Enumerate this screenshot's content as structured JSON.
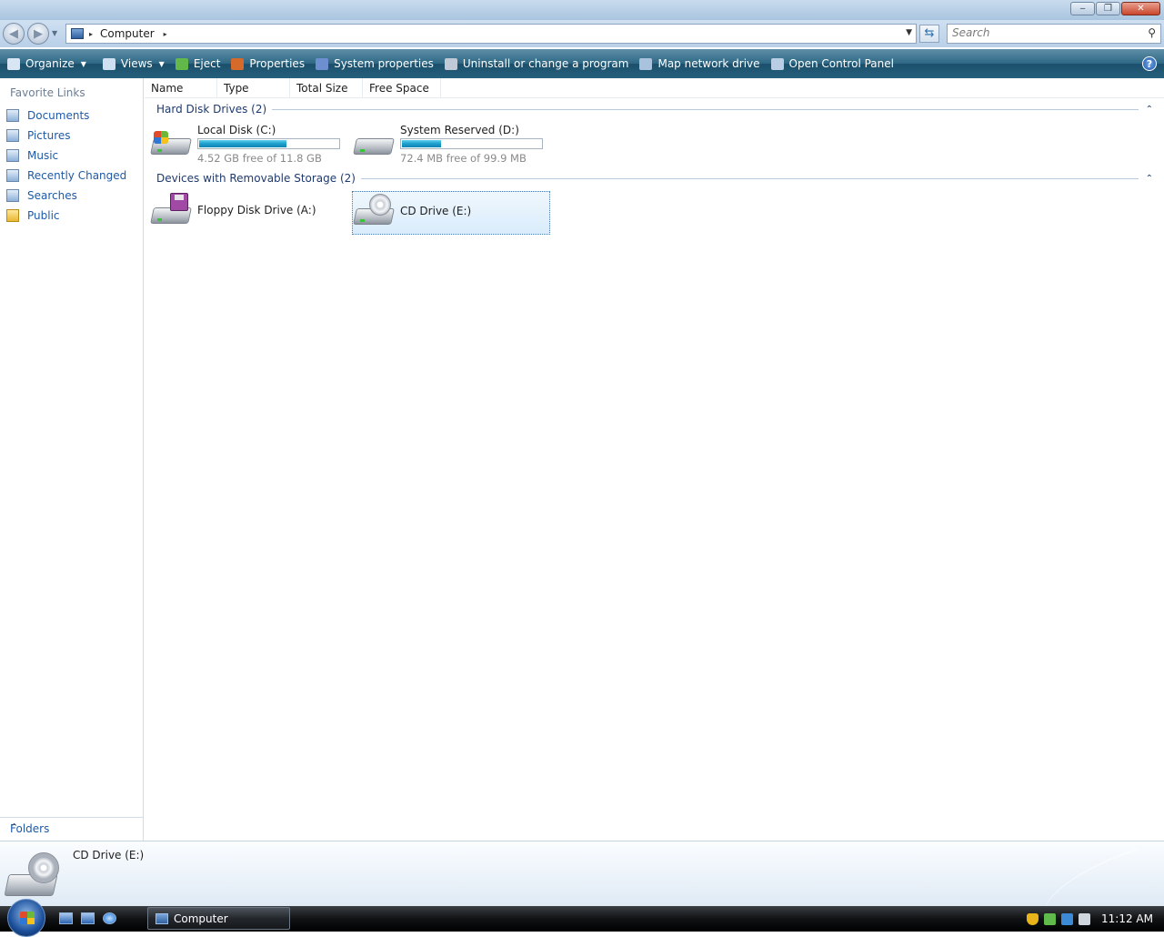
{
  "window": {
    "min_label": "‒",
    "max_label": "❐",
    "close_label": "✕"
  },
  "address": {
    "crumb": "Computer",
    "separator": "▸",
    "search_placeholder": "Search"
  },
  "toolbar": {
    "items": [
      {
        "label": "Organize",
        "icon": "organize-icon",
        "has_arrow": true
      },
      {
        "label": "Views",
        "icon": "views-icon",
        "has_arrow": true
      },
      {
        "label": "Eject",
        "icon": "eject-icon"
      },
      {
        "label": "Properties",
        "icon": "properties-icon"
      },
      {
        "label": "System properties",
        "icon": "system-properties-icon"
      },
      {
        "label": "Uninstall or change a program",
        "icon": "uninstall-icon"
      },
      {
        "label": "Map network drive",
        "icon": "network-drive-icon"
      },
      {
        "label": "Open Control Panel",
        "icon": "control-panel-icon"
      }
    ],
    "help_label": "?"
  },
  "sidebar": {
    "header": "Favorite Links",
    "items": [
      {
        "label": "Documents",
        "icon": "documents-icon"
      },
      {
        "label": "Pictures",
        "icon": "pictures-icon"
      },
      {
        "label": "Music",
        "icon": "music-icon"
      },
      {
        "label": "Recently Changed",
        "icon": "recently-changed-icon"
      },
      {
        "label": "Searches",
        "icon": "searches-icon"
      },
      {
        "label": "Public",
        "icon": "public-folder-icon"
      }
    ],
    "folders_label": "Folders"
  },
  "columns": [
    "Name",
    "Type",
    "Total Size",
    "Free Space"
  ],
  "groups": [
    {
      "title": "Hard Disk Drives (2)",
      "drives": [
        {
          "name": "Local Disk (C:)",
          "free_text": "4.52 GB free of 11.8 GB",
          "used_fraction": 0.617,
          "icon": "hard-disk-windows-icon"
        },
        {
          "name": "System Reserved (D:)",
          "free_text": "72.4 MB free of 99.9 MB",
          "used_fraction": 0.275,
          "icon": "hard-disk-icon"
        }
      ]
    },
    {
      "title": "Devices with Removable Storage (2)",
      "drives": [
        {
          "name": "Floppy Disk Drive (A:)",
          "icon": "floppy-drive-icon"
        },
        {
          "name": "CD Drive (E:)",
          "icon": "cd-drive-icon",
          "selected": true
        }
      ]
    }
  ],
  "details": {
    "name": "CD Drive (E:)"
  },
  "taskbar": {
    "task_label": "Computer",
    "clock": "11:12 AM"
  },
  "colors": {
    "link": "#1e5aa8",
    "bar_fill": "#1c9ecb",
    "command_bar": "#25607d"
  }
}
